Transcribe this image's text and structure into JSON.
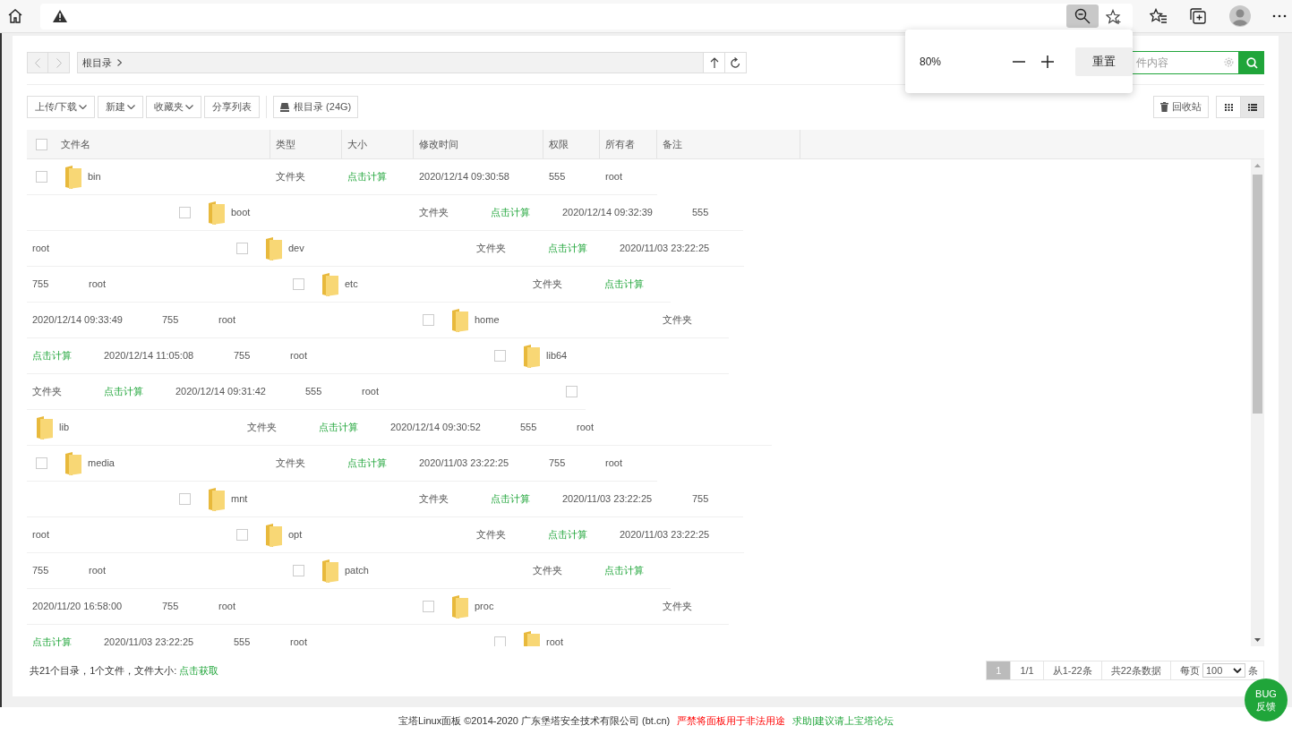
{
  "zoom_popup": {
    "zoom": "80%",
    "reset_button": "重置"
  },
  "path_bar": {
    "crumbs": [
      "根目录"
    ]
  },
  "search": {
    "placeholder": "件内容"
  },
  "toolbar": {
    "buttons": [
      {
        "label": "上传/下载",
        "dropdown": true
      },
      {
        "label": "新建",
        "dropdown": true
      },
      {
        "label": "收藏夹",
        "dropdown": true
      },
      {
        "label": "分享列表",
        "dropdown": false
      }
    ],
    "disk_button": "根目录 (24G)",
    "recycle_button": "回收站",
    "views": [
      {
        "kind": "grid",
        "selected": false
      },
      {
        "kind": "list",
        "selected": true
      }
    ]
  },
  "table": {
    "select_all_checked": false,
    "columns": [
      "文件名",
      "类型",
      "大小",
      "修改时间",
      "权限",
      "所有者",
      "备注"
    ],
    "lines": [
      {
        "cells": [
          {
            "kind": "checkbox",
            "checked": false
          },
          {
            "kind": "name",
            "text": "bin"
          },
          {
            "kind": "type",
            "text": "文件夹"
          },
          {
            "kind": "size",
            "text": "点击计算"
          },
          {
            "kind": "modified",
            "text": "2020/12/14 09:30:58"
          },
          {
            "kind": "permission",
            "text": "555"
          },
          {
            "kind": "owner",
            "text": "root"
          }
        ]
      },
      {
        "cells": [
          {
            "kind": "checkbox",
            "checked": false
          },
          {
            "kind": "name",
            "text": "boot"
          },
          {
            "kind": "type",
            "text": "文件夹"
          },
          {
            "kind": "size",
            "text": "点击计算"
          },
          {
            "kind": "modified",
            "text": "2020/12/14 09:32:39"
          },
          {
            "kind": "permission",
            "text": "555"
          }
        ]
      },
      {
        "cells": [
          {
            "kind": "owner",
            "text": "root"
          },
          {
            "kind": "checkbox",
            "checked": false
          },
          {
            "kind": "name",
            "text": "dev"
          },
          {
            "kind": "type",
            "text": "文件夹"
          },
          {
            "kind": "size",
            "text": "点击计算"
          },
          {
            "kind": "modified",
            "text": "2020/11/03 23:22:25"
          }
        ]
      },
      {
        "cells": [
          {
            "kind": "permission",
            "text": "755"
          },
          {
            "kind": "owner",
            "text": "root"
          },
          {
            "kind": "checkbox",
            "checked": false
          },
          {
            "kind": "name",
            "text": "etc"
          },
          {
            "kind": "type",
            "text": "文件夹"
          },
          {
            "kind": "size",
            "text": "点击计算"
          }
        ]
      },
      {
        "cells": [
          {
            "kind": "modified",
            "text": "2020/12/14 09:33:49"
          },
          {
            "kind": "permission",
            "text": "755"
          },
          {
            "kind": "owner",
            "text": "root"
          },
          {
            "kind": "checkbox",
            "checked": false
          },
          {
            "kind": "name",
            "text": "home"
          },
          {
            "kind": "type",
            "text": "文件夹"
          }
        ]
      },
      {
        "cells": [
          {
            "kind": "size",
            "text": "点击计算"
          },
          {
            "kind": "modified",
            "text": "2020/12/14 11:05:08"
          },
          {
            "kind": "permission",
            "text": "755"
          },
          {
            "kind": "owner",
            "text": "root"
          },
          {
            "kind": "checkbox",
            "checked": false
          },
          {
            "kind": "name",
            "text": "lib64"
          }
        ]
      },
      {
        "cells": [
          {
            "kind": "type",
            "text": "文件夹"
          },
          {
            "kind": "size",
            "text": "点击计算"
          },
          {
            "kind": "modified",
            "text": "2020/12/14 09:31:42"
          },
          {
            "kind": "permission",
            "text": "555"
          },
          {
            "kind": "owner",
            "text": "root"
          },
          {
            "kind": "checkbox",
            "checked": false
          }
        ]
      },
      {
        "cells": [
          {
            "kind": "name",
            "text": "lib"
          },
          {
            "kind": "type",
            "text": "文件夹"
          },
          {
            "kind": "size",
            "text": "点击计算"
          },
          {
            "kind": "modified",
            "text": "2020/12/14 09:30:52"
          },
          {
            "kind": "permission",
            "text": "555"
          },
          {
            "kind": "owner",
            "text": "root"
          }
        ]
      },
      {
        "cells": [
          {
            "kind": "checkbox",
            "checked": false
          },
          {
            "kind": "name",
            "text": "media"
          },
          {
            "kind": "type",
            "text": "文件夹"
          },
          {
            "kind": "size",
            "text": "点击计算"
          },
          {
            "kind": "modified",
            "text": "2020/11/03 23:22:25"
          },
          {
            "kind": "permission",
            "text": "755"
          },
          {
            "kind": "owner",
            "text": "root"
          }
        ]
      },
      {
        "cells": [
          {
            "kind": "checkbox",
            "checked": false
          },
          {
            "kind": "name",
            "text": "mnt"
          },
          {
            "kind": "type",
            "text": "文件夹"
          },
          {
            "kind": "size",
            "text": "点击计算"
          },
          {
            "kind": "modified",
            "text": "2020/11/03 23:22:25"
          },
          {
            "kind": "permission",
            "text": "755"
          }
        ]
      },
      {
        "cells": [
          {
            "kind": "owner",
            "text": "root"
          },
          {
            "kind": "checkbox",
            "checked": false
          },
          {
            "kind": "name",
            "text": "opt"
          },
          {
            "kind": "type",
            "text": "文件夹"
          },
          {
            "kind": "size",
            "text": "点击计算"
          },
          {
            "kind": "modified",
            "text": "2020/11/03 23:22:25"
          }
        ]
      },
      {
        "cells": [
          {
            "kind": "permission",
            "text": "755"
          },
          {
            "kind": "owner",
            "text": "root"
          },
          {
            "kind": "checkbox",
            "checked": false
          },
          {
            "kind": "name",
            "text": "patch"
          },
          {
            "kind": "type",
            "text": "文件夹"
          },
          {
            "kind": "size",
            "text": "点击计算"
          }
        ]
      },
      {
        "cells": [
          {
            "kind": "modified",
            "text": "2020/11/20 16:58:00"
          },
          {
            "kind": "permission",
            "text": "755"
          },
          {
            "kind": "owner",
            "text": "root"
          },
          {
            "kind": "checkbox",
            "checked": false
          },
          {
            "kind": "name",
            "text": "proc"
          },
          {
            "kind": "type",
            "text": "文件夹"
          }
        ]
      },
      {
        "cells": [
          {
            "kind": "size",
            "text": "点击计算"
          },
          {
            "kind": "modified",
            "text": "2020/11/03 23:22:25"
          },
          {
            "kind": "permission",
            "text": "555"
          },
          {
            "kind": "owner",
            "text": "root"
          },
          {
            "kind": "checkbox",
            "checked": false
          },
          {
            "kind": "name",
            "text": "root"
          }
        ]
      }
    ]
  },
  "summary": {
    "text": "共21个目录，1个文件，文件大小: ",
    "link": "点击获取"
  },
  "pagination": {
    "pages": [
      {
        "label": "1",
        "selected": true
      }
    ],
    "page_info": "1/1",
    "range": "从1-22条",
    "total": "共22条数据",
    "per_page_label": "每页",
    "per_page": "100",
    "unit": "条"
  },
  "footer": {
    "copyright": "宝塔Linux面板 ©2014-2020 广东堡塔安全技术有限公司 (bt.cn)",
    "warning": "严禁将面板用于非法用途",
    "forum_link": "求助|建议请上宝塔论坛"
  },
  "bug_button": [
    "BUG",
    "反馈"
  ]
}
